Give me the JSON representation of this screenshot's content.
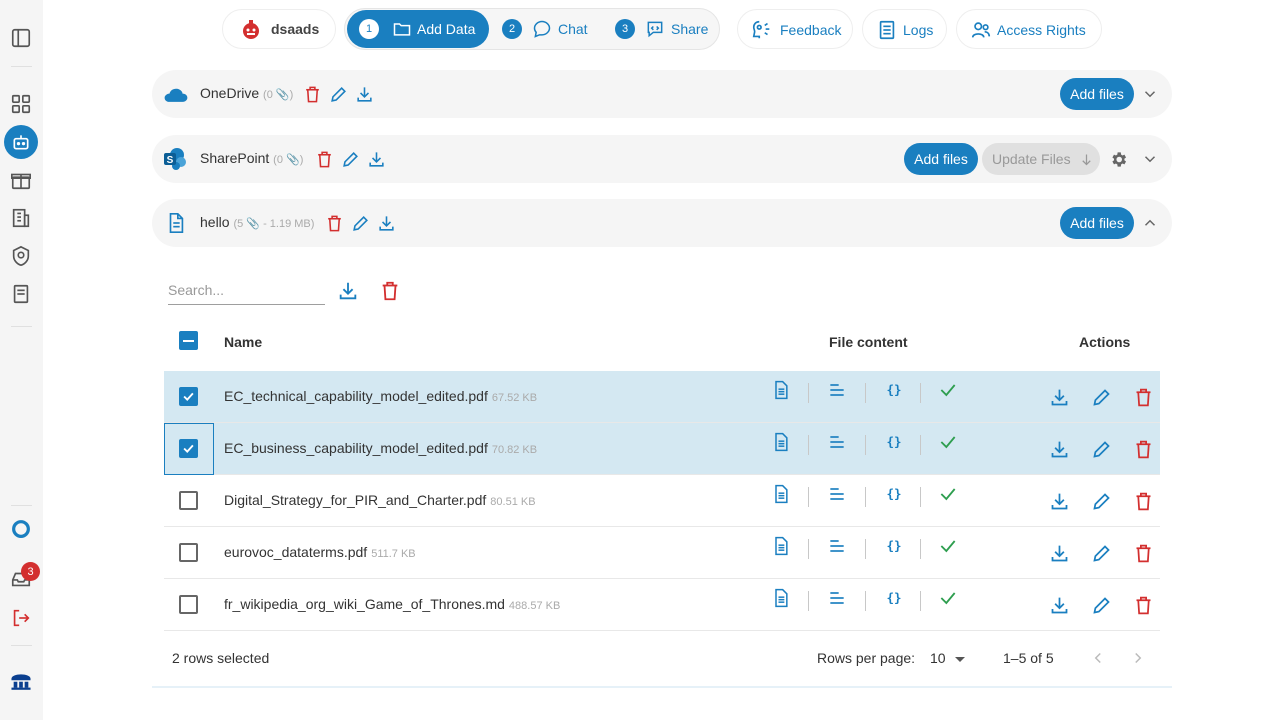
{
  "header": {
    "project_name": "dsaads",
    "steps": [
      {
        "num": "1",
        "label": "Add Data",
        "active": true
      },
      {
        "num": "2",
        "label": "Chat",
        "active": false
      },
      {
        "num": "3",
        "label": "Share",
        "active": false
      }
    ],
    "feedback_label": "Feedback",
    "logs_label": "Logs",
    "access_label": "Access Rights"
  },
  "sidebar": {
    "icons": [
      "panel-toggle-icon",
      "grid-icon",
      "robot-icon",
      "gift-icon",
      "building-icon",
      "shield-icon",
      "book-icon",
      "chat-bubble-icon",
      "inbox-icon",
      "logout-icon",
      "brand-logo"
    ],
    "notification_count": "3"
  },
  "sources": [
    {
      "name": "OneDrive",
      "meta": "(0 📎)",
      "add_label": "Add files"
    },
    {
      "name": "SharePoint",
      "meta": "(0 📎)",
      "add_label": "Add files",
      "update_label": "Update Files"
    },
    {
      "name": "hello",
      "meta": "(5 📎 - 1.19 MB)",
      "add_label": "Add files"
    }
  ],
  "table": {
    "search_placeholder": "Search...",
    "col_name": "Name",
    "col_content": "File content",
    "col_actions": "Actions",
    "rows": [
      {
        "name": "EC_technical_capability_model_edited.pdf",
        "size": "67.52 KB",
        "selected": true
      },
      {
        "name": "EC_business_capability_model_edited.pdf",
        "size": "70.82 KB",
        "selected": true
      },
      {
        "name": "Digital_Strategy_for_PIR_and_Charter.pdf",
        "size": "80.51 KB",
        "selected": false
      },
      {
        "name": "eurovoc_dataterms.pdf",
        "size": "511.7 KB",
        "selected": false
      },
      {
        "name": "fr_wikipedia_org_wiki_Game_of_Thrones.md",
        "size": "488.57 KB",
        "selected": false
      }
    ],
    "selected_text": "2 rows selected",
    "rows_per_page_label": "Rows per page:",
    "rows_per_page": "10",
    "range_text": "1–5 of 5"
  },
  "colors": {
    "accent": "#1a7fc0",
    "danger": "#d32f2f",
    "success": "#2e9e4f"
  }
}
